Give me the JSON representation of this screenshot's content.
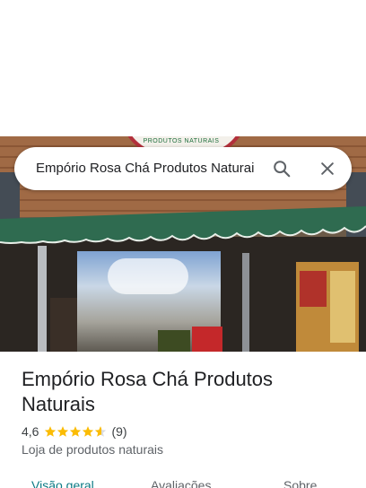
{
  "search": {
    "query": "Empório Rosa Chá Produtos Naturai",
    "search_icon": "search-icon",
    "clear_icon": "close-icon"
  },
  "photo": {
    "sign_text": "PRODUTOS NATURAIS"
  },
  "place": {
    "title": "Empório Rosa Chá Produtos Naturais",
    "rating": "4,6",
    "stars_value": 4.6,
    "review_count": "(9)",
    "category": "Loja de produtos naturais"
  },
  "tabs": [
    {
      "label": "Visão geral",
      "active": true
    },
    {
      "label": "Avaliações",
      "active": false
    },
    {
      "label": "Sobre",
      "active": false
    }
  ],
  "colors": {
    "star": "#fbbc04",
    "active_tab": "#0b7a84"
  }
}
